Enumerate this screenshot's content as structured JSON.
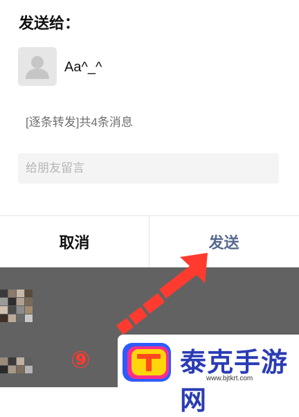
{
  "dialog": {
    "title": "发送给：",
    "recipient": {
      "name": "Aa^_^",
      "avatar_icon": "default-user-icon"
    },
    "forward_summary": "[逐条转发]共4条消息",
    "message_input": {
      "placeholder": "给朋友留言",
      "value": ""
    },
    "buttons": {
      "cancel": "取消",
      "send": "发送"
    }
  },
  "overlay": {
    "step_label": "⑨"
  },
  "watermark": {
    "name": "泰克手游网",
    "url": "www.bjtkrt.com"
  },
  "colors": {
    "send_accent": "#57698f",
    "arrow": "#ff3b30",
    "watermark_text": "#2a3cb5"
  }
}
